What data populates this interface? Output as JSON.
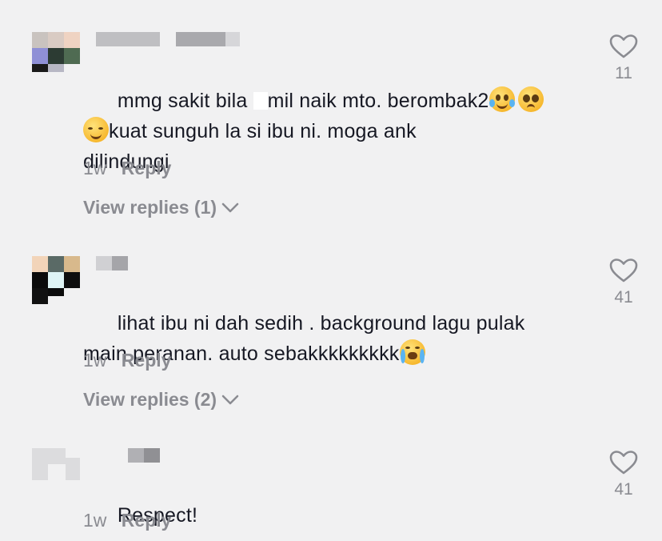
{
  "comments": [
    {
      "text_part1": "mmg sakit bila ",
      "text_part2": "mil naik mto. berombak2",
      "text_line2": "kuat sunguh la si ibu ni. moga ank",
      "text_line3": "dilindungi",
      "time": "1w",
      "reply_label": "Reply",
      "view_replies": "View replies (1)",
      "likes": "11",
      "emojis": [
        "joy-emoji",
        "pleading-emoji",
        "relieved-emoji"
      ]
    },
    {
      "text_line1": "lihat ibu ni dah sedih . background lagu pulak",
      "text_line2": "main peranan. auto sebakkkkkkkkk",
      "time": "1w",
      "reply_label": "Reply",
      "view_replies": "View replies (2)",
      "likes": "41",
      "emojis": [
        "loudly-crying-emoji"
      ]
    },
    {
      "text_line1": "Respect!",
      "time": "1w",
      "reply_label": "Reply",
      "likes": "41"
    }
  ],
  "colors": {
    "background": "#f1f1f2",
    "text": "#161823",
    "secondary": "#8a8b91"
  }
}
